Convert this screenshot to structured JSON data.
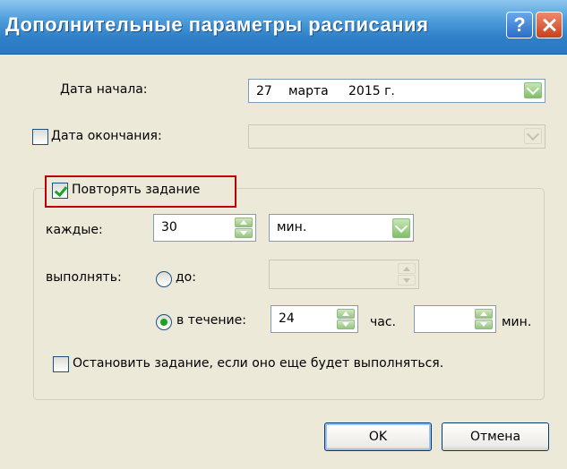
{
  "window": {
    "title": "Дополнительные параметры расписания",
    "help_glyph": "?",
    "close_glyph": "✕"
  },
  "start_date": {
    "label": "Дата начала:",
    "day": "27",
    "month": "марта",
    "year": "2015 г."
  },
  "end_date": {
    "label": "Дата окончания:",
    "checked": false,
    "value": ""
  },
  "repeat": {
    "label": "Повторять задание",
    "checked": true,
    "every_label": "каждые:",
    "every_value": "30",
    "unit_value": "мин.",
    "run_label": "выполнять:",
    "until_label": "до:",
    "until_value": "",
    "during_label": "в течение:",
    "hours_value": "24",
    "hours_unit": "час.",
    "minutes_value": "",
    "minutes_unit": "мин.",
    "selected_option": "в течение",
    "stop_label": "Остановить задание, если оно еще будет выполняться.",
    "stop_checked": false
  },
  "buttons": {
    "ok": "OK",
    "cancel": "Отмена"
  },
  "colors": {
    "dialog_bg": "#ece9d8",
    "titlebar": "#2f7fc8",
    "highlight": "#c00000",
    "check": "#21a121"
  }
}
